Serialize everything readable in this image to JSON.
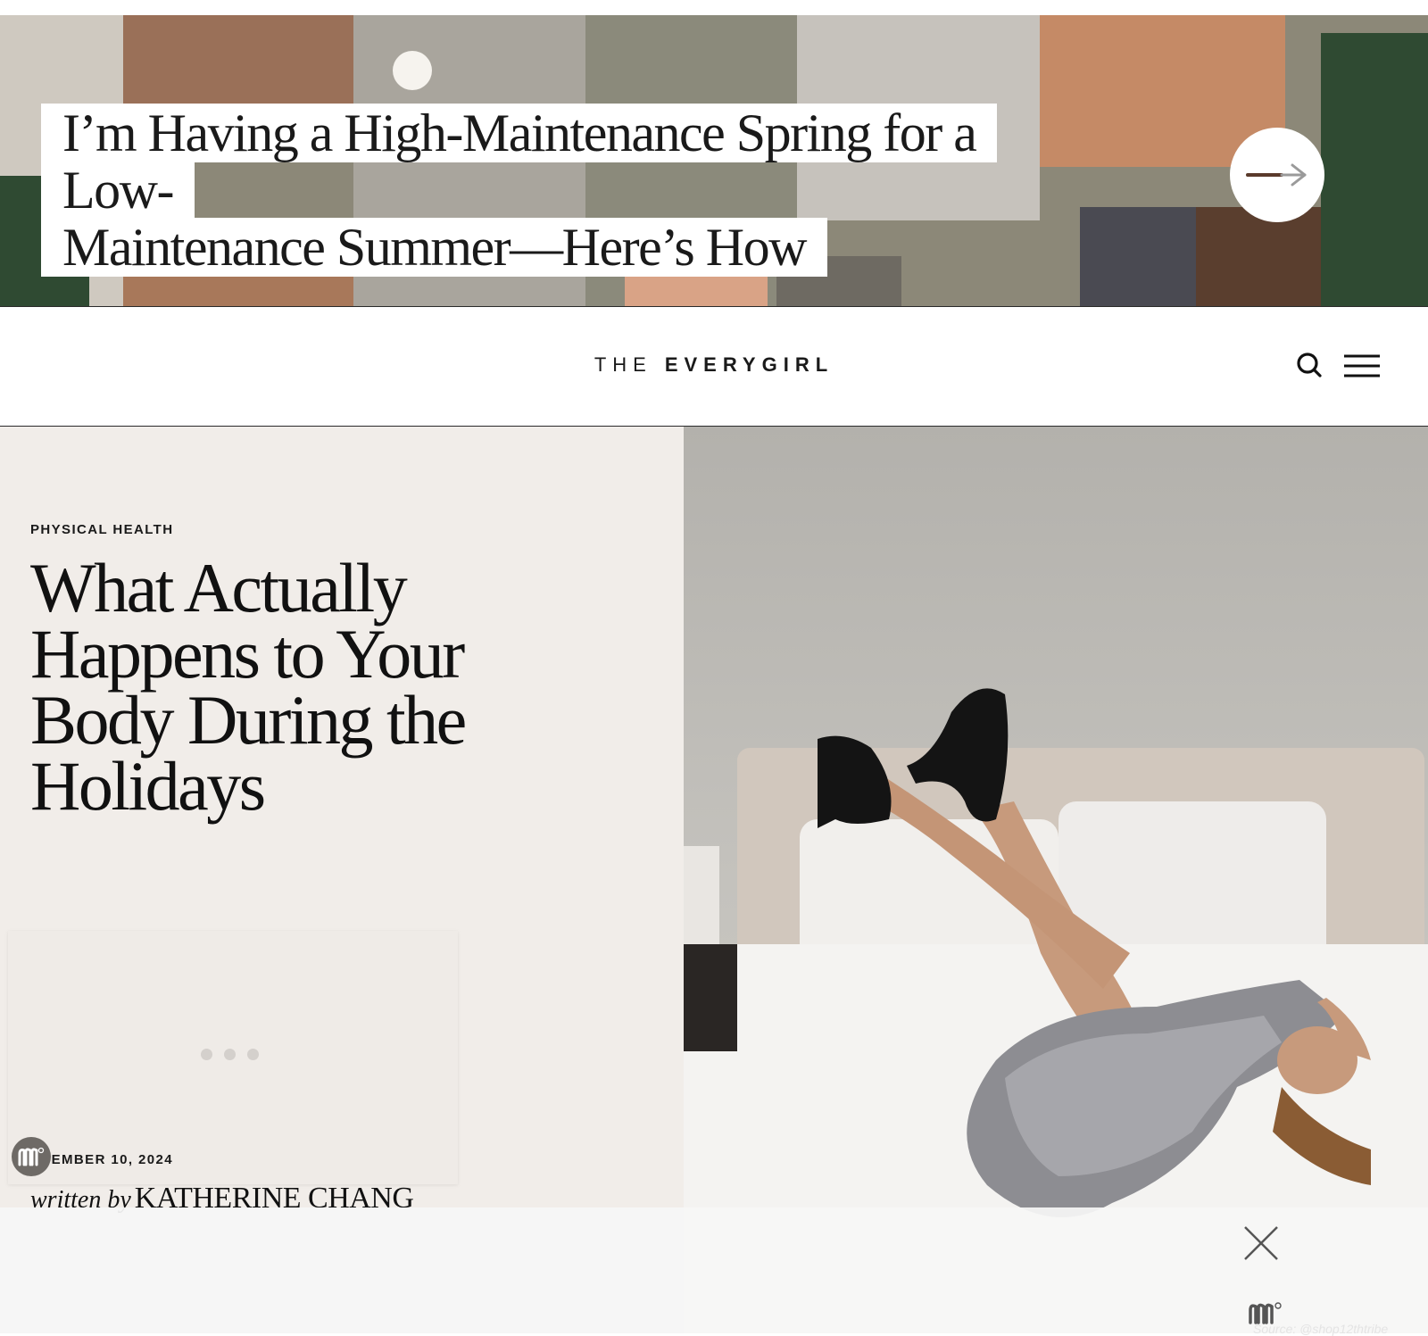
{
  "banner": {
    "title_line1": "I’m Having a High-Maintenance Spring for a Low-",
    "title_line2": "Maintenance Summer—Here’s How",
    "arrow_icon": "arrow-right-icon"
  },
  "header": {
    "logo_the": "THE",
    "logo_brand": "EVERYGIRL",
    "search_icon": "search-icon",
    "menu_icon": "hamburger-menu-icon"
  },
  "article": {
    "category": "PHYSICAL HEALTH",
    "title": "What Actually Happens to Your Body During the Holidays",
    "date": "ECEMBER 10, 2024",
    "byline_prefix": "written by",
    "author": "KATHERINE CHANG",
    "photo_credit": "Source: @shop12thtribe"
  },
  "ad": {
    "badge_icon": "mediavine-logo-icon",
    "close_icon": "close-icon",
    "loading_icon": "loading-dots-icon"
  },
  "colors": {
    "hero_bg": "#f1ede9",
    "text": "#111111",
    "overlay": "#f6f6f6"
  }
}
